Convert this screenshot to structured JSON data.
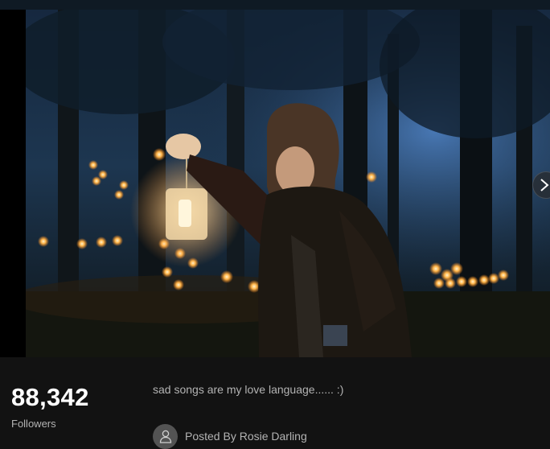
{
  "gallery": {
    "image_alt": "",
    "next_icon": "chevron-right-icon"
  },
  "stats": {
    "followers_count": "88,342",
    "followers_label": "Followers"
  },
  "post": {
    "text": "sad songs are my love language...... :)",
    "author_label": "Posted By Rosie Darling",
    "avatar_icon": "user-icon"
  },
  "colors": {
    "background": "#121212",
    "secondary_text": "#b3b3b3",
    "avatar_bg": "#535353"
  }
}
